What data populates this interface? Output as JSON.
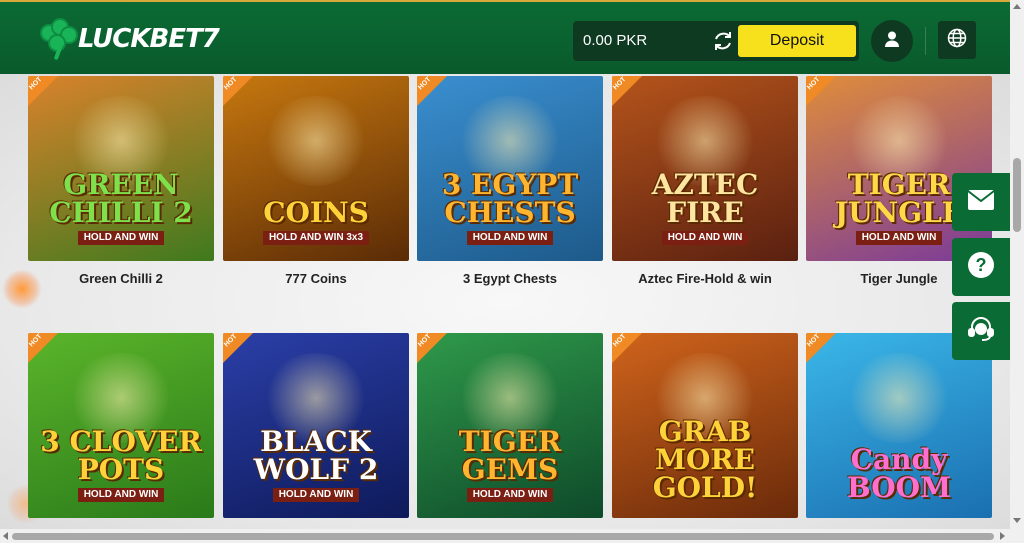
{
  "header": {
    "logo_text": "LUCKBET7",
    "balance": "0.00 PKR",
    "deposit_label": "Deposit"
  },
  "games": [
    {
      "title": "Green Chilli 2",
      "badge": "HOT",
      "art_main": "GREEN CHILLI 2",
      "art_sub": "HOLD AND WIN",
      "bg": "#d9822b",
      "bg2": "#3f7a1e",
      "text_color": "#7ee04a"
    },
    {
      "title": "777 Coins",
      "badge": "HOT",
      "art_main": "COINS",
      "art_sub": "HOLD AND WIN 3x3",
      "bg": "#c7780f",
      "bg2": "#5a2b06",
      "text_color": "#ffd23a"
    },
    {
      "title": "3 Egypt Chests",
      "badge": "HOT",
      "art_main": "3 EGYPT CHESTS",
      "art_sub": "HOLD AND WIN",
      "bg": "#3a8fd0",
      "bg2": "#1d5a8a",
      "text_color": "#ffb530"
    },
    {
      "title": "Aztec Fire-Hold & win",
      "badge": "HOT",
      "art_main": "AZTEC FIRE",
      "art_sub": "HOLD AND WIN",
      "bg": "#b5541b",
      "bg2": "#5a2010",
      "text_color": "#ffe6a0"
    },
    {
      "title": "Tiger Jungle",
      "badge": "HOT",
      "art_main": "TIGER JUNGLE",
      "art_sub": "HOLD AND WIN",
      "bg": "#e08d3a",
      "bg2": "#7a3a9a",
      "text_color": "#ffd84a"
    },
    {
      "title": "",
      "badge": "HOT",
      "art_main": "3 CLOVER POTS",
      "art_sub": "HOLD AND WIN",
      "bg": "#5bb52a",
      "bg2": "#2a7a1a",
      "text_color": "#ffd23a"
    },
    {
      "title": "",
      "badge": "HOT",
      "art_main": "BLACK WOLF 2",
      "art_sub": "HOLD AND WIN",
      "bg": "#2b3fa8",
      "bg2": "#0e1a5a",
      "text_color": "#ffffff"
    },
    {
      "title": "",
      "badge": "HOT",
      "art_main": "TIGER GEMS",
      "art_sub": "HOLD AND WIN",
      "bg": "#2f9a4a",
      "bg2": "#0e4a2a",
      "text_color": "#ffb530"
    },
    {
      "title": "",
      "badge": "HOT",
      "art_main": "GRAB MORE GOLD!",
      "art_sub": "",
      "bg": "#d0641c",
      "bg2": "#6a2a0a",
      "text_color": "#ffd23a"
    },
    {
      "title": "",
      "badge": "HOT",
      "art_main": "Candy BOOM",
      "art_sub": "",
      "bg": "#3bb7e8",
      "bg2": "#1a6fb0",
      "text_color": "#ff6fd0"
    }
  ],
  "side_buttons": [
    {
      "icon": "mail-icon"
    },
    {
      "icon": "help-icon"
    },
    {
      "icon": "chat-support-icon"
    }
  ],
  "colors": {
    "brand_green": "#0b6b34",
    "deposit_yellow": "#f7e01c",
    "hot_orange": "#f08a24"
  }
}
